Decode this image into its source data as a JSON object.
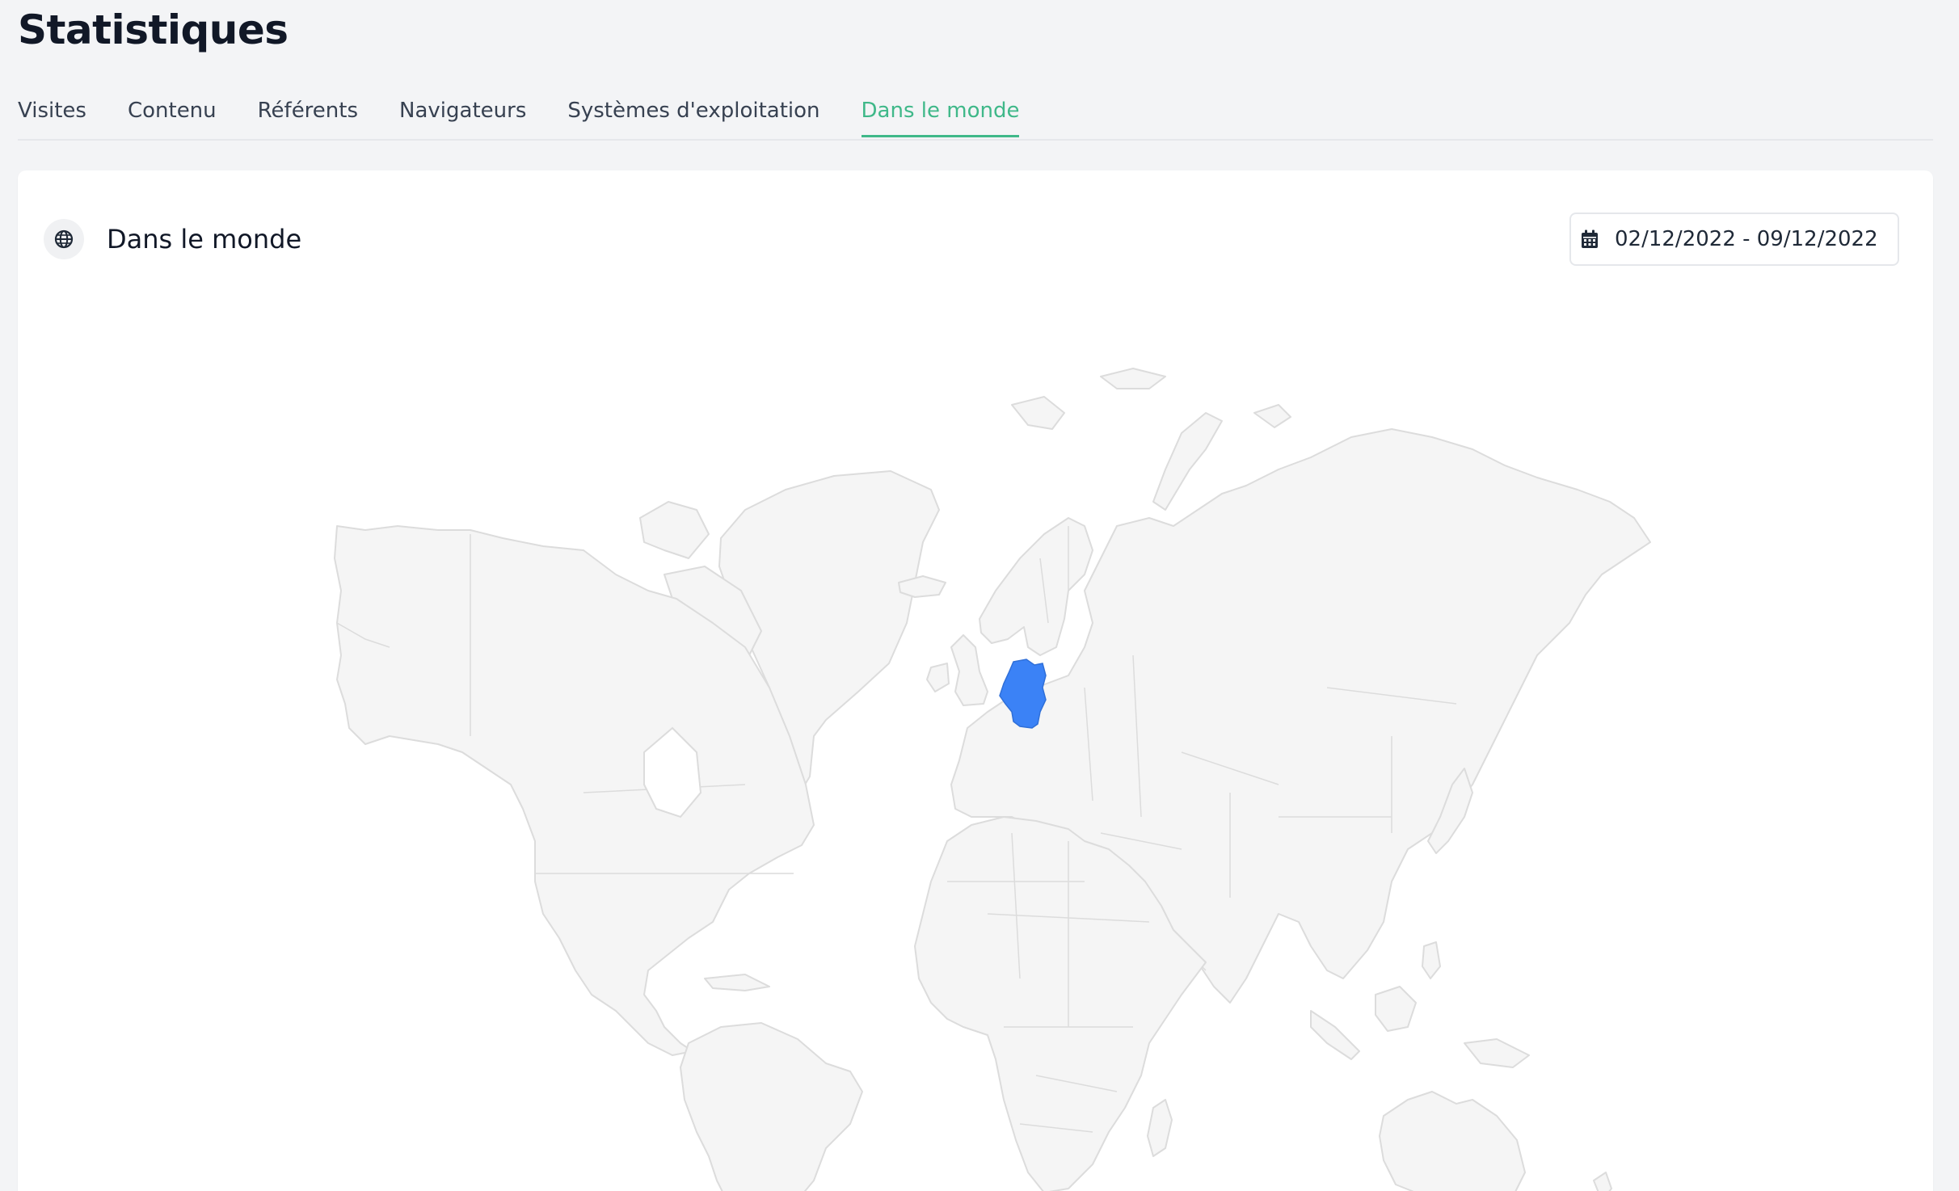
{
  "page": {
    "title": "Statistiques"
  },
  "tabs": [
    {
      "label": "Visites",
      "active": false
    },
    {
      "label": "Contenu",
      "active": false
    },
    {
      "label": "Référents",
      "active": false
    },
    {
      "label": "Navigateurs",
      "active": false
    },
    {
      "label": "Systèmes d'exploitation",
      "active": false
    },
    {
      "label": "Dans le monde",
      "active": true
    }
  ],
  "card": {
    "title": "Dans le monde",
    "icon": "globe-icon",
    "date_range": {
      "icon": "calendar-icon",
      "value": "02/12/2022 - 09/12/2022"
    }
  },
  "map": {
    "highlighted_countries": [
      "Germany"
    ],
    "highlight_color": "#3b82f6",
    "land_color": "#f5f5f5",
    "border_color": "#dcdcdc"
  },
  "colors": {
    "accent": "#3fb889",
    "background": "#f3f4f6",
    "card": "#ffffff"
  }
}
